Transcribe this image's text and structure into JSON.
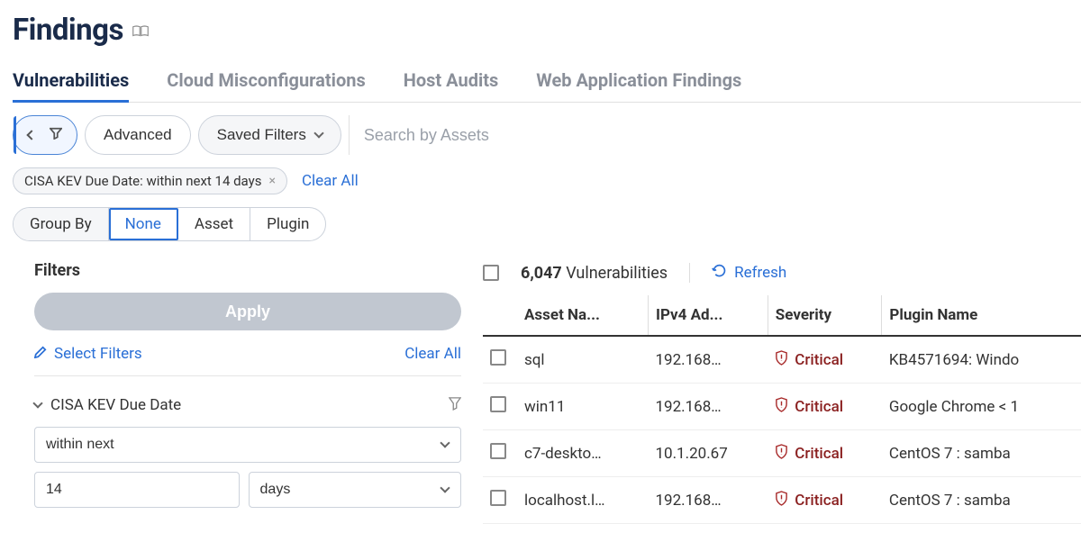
{
  "page": {
    "title": "Findings"
  },
  "tabs": [
    {
      "label": "Vulnerabilities",
      "active": true
    },
    {
      "label": "Cloud Misconfigurations",
      "active": false
    },
    {
      "label": "Host Audits",
      "active": false
    },
    {
      "label": "Web Application Findings",
      "active": false
    }
  ],
  "toolbar": {
    "advanced_label": "Advanced",
    "saved_filters_label": "Saved Filters",
    "search_placeholder": "Search by Assets"
  },
  "active_filters": [
    {
      "text": "CISA KEV Due Date: within next 14 days"
    }
  ],
  "clear_all_label": "Clear All",
  "groupby": {
    "label": "Group By",
    "options": [
      {
        "label": "None",
        "active": true
      },
      {
        "label": "Asset",
        "active": false
      },
      {
        "label": "Plugin",
        "active": false
      }
    ]
  },
  "filters_panel": {
    "heading": "Filters",
    "apply_label": "Apply",
    "select_filters_label": "Select Filters",
    "clear_all_label": "Clear All",
    "section": {
      "name": "CISA KEV Due Date",
      "operator": "within next",
      "value": "14",
      "unit": "days"
    }
  },
  "results": {
    "count": "6,047",
    "count_label": "Vulnerabilities",
    "refresh_label": "Refresh",
    "columns": [
      "Asset Na...",
      "IPv4 Ad...",
      "Severity",
      "Plugin Name"
    ],
    "rows": [
      {
        "asset": "sql",
        "ip": "192.168…",
        "severity": "Critical",
        "plugin": "KB4571694: Windo"
      },
      {
        "asset": "win11",
        "ip": "192.168…",
        "severity": "Critical",
        "plugin": "Google Chrome < 1"
      },
      {
        "asset": "c7-deskto…",
        "ip": "10.1.20.67",
        "severity": "Critical",
        "plugin": "CentOS 7 : samba"
      },
      {
        "asset": "localhost.l…",
        "ip": "192.168…",
        "severity": "Critical",
        "plugin": "CentOS 7 : samba"
      }
    ]
  }
}
